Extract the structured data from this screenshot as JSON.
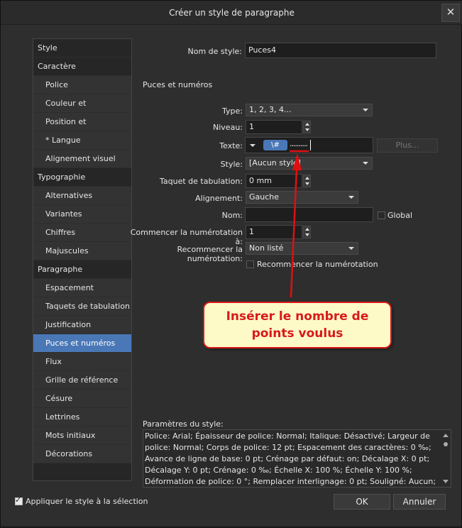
{
  "window": {
    "title": "Créer un style de paragraphe",
    "close_label": "✕"
  },
  "sidebar": {
    "items": [
      {
        "label": "Style",
        "kind": "cat"
      },
      {
        "label": "Caractère",
        "kind": "cat"
      },
      {
        "label": "Police",
        "kind": "sub"
      },
      {
        "label": "Couleur et décorations",
        "kind": "sub"
      },
      {
        "label": "Position et Transformer",
        "kind": "sub"
      },
      {
        "label": "* Langue",
        "kind": "sub"
      },
      {
        "label": "Alignement visuel",
        "kind": "sub"
      },
      {
        "label": "Typographie",
        "kind": "cat"
      },
      {
        "label": "Alternatives",
        "kind": "sub"
      },
      {
        "label": "Variantes",
        "kind": "sub"
      },
      {
        "label": "Chiffres",
        "kind": "sub"
      },
      {
        "label": "Majuscules",
        "kind": "sub"
      },
      {
        "label": "Paragraphe",
        "kind": "cat"
      },
      {
        "label": "Espacement",
        "kind": "sub"
      },
      {
        "label": "Taquets de tabulation",
        "kind": "sub"
      },
      {
        "label": "Justification",
        "kind": "sub"
      },
      {
        "label": "Puces et numéros",
        "kind": "sub",
        "selected": true
      },
      {
        "label": "Flux",
        "kind": "sub"
      },
      {
        "label": "Grille de référence",
        "kind": "sub"
      },
      {
        "label": "Césure",
        "kind": "sub"
      },
      {
        "label": "Lettrines",
        "kind": "sub"
      },
      {
        "label": "Mots initiaux",
        "kind": "sub"
      },
      {
        "label": "Décorations",
        "kind": "sub"
      }
    ]
  },
  "form": {
    "style_name_label": "Nom de style:",
    "style_name_value": "Puces4",
    "section_title": "Puces et numéros",
    "type_label": "Type:",
    "type_value": "1, 2, 3, 4...",
    "level_label": "Niveau:",
    "level_value": "1",
    "text_label": "Texte:",
    "text_token": "\\#",
    "text_dots": "..........",
    "more_button": "Plus...",
    "style_label": "Style:",
    "style_value": "[Aucun style]",
    "tab_stop_label": "Taquet de tabulation:",
    "tab_stop_value": "0 mm",
    "alignment_label": "Alignement:",
    "alignment_value": "Gauche",
    "name_label": "Nom:",
    "name_value": "",
    "global_label": "Global",
    "start_label": "Commencer la numérotation à:",
    "start_value": "1",
    "restart_label": "Recommencer la numérotation:",
    "restart_value": "Non listé",
    "restart_checkbox_label": "Recommencer la numérotation"
  },
  "annotation": {
    "line1": "Insérer le nombre de",
    "line2": "points voulus",
    "color": "#d81a1a",
    "background": "#fefac8"
  },
  "params": {
    "label": "Paramètres du style:",
    "lines": [
      "Police: Arial; Épaisseur de police: Normal; Italique: Désactivé; Largeur de",
      "police: Normal; Corps de police: 12 pt; Espacement des caractères: 0 ‰;",
      "Avance de ligne de base: 0 pt; Crénage par défaut: on; Décalage X: 0 pt;",
      "Décalage Y: 0 pt; Crénage: 0 ‰; Échelle X: 100 %; Échelle Y: 100 %;",
      "Déformation de police: 0 °; Remplacer interlignage: 0 pt; Souligné: Aucun;"
    ]
  },
  "footer": {
    "apply_label": "Appliquer le style à la sélection",
    "apply_checked": true,
    "ok_button": "OK",
    "cancel_button": "Annuler"
  },
  "colors": {
    "accent": "#4a78b7",
    "selected_token": "#4a78b7"
  }
}
